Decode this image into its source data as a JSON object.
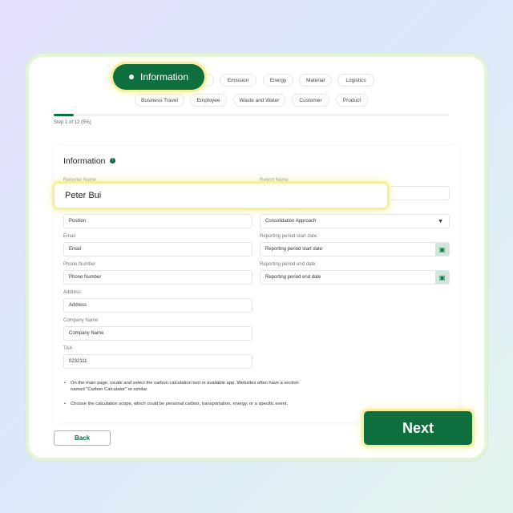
{
  "stepper": {
    "active": "Information",
    "row1": [
      "Emission",
      "Energy",
      "Material",
      "Logistics"
    ],
    "row2": [
      "Business Travel",
      "Employee",
      "Waste and Water",
      "Customer",
      "Product"
    ]
  },
  "progress": {
    "percent": 5,
    "text": "Step 1 of 12 (5%)"
  },
  "form": {
    "title": "Information",
    "reporter_name": {
      "label": "Reporter Name",
      "value": "Peter Bui"
    },
    "report_name": {
      "label": "Report Name",
      "value": ""
    },
    "position": {
      "label": "Position",
      "placeholder": "Position"
    },
    "consolidation": {
      "label": "Consolidation Approach",
      "value": "Consolidation Approach"
    },
    "email": {
      "label": "Email",
      "placeholder": "Email"
    },
    "start_date": {
      "label": "Reporting period start date:",
      "placeholder": "Reporting period start date"
    },
    "phone": {
      "label": "Phone Number",
      "placeholder": "Phone Number"
    },
    "end_date": {
      "label": "Reporting period end date:",
      "placeholder": "Reporting period end date"
    },
    "address": {
      "label": "Address",
      "placeholder": "Address"
    },
    "company": {
      "label": "Company Name",
      "placeholder": "Company Name"
    },
    "tax": {
      "label": "TAX",
      "value": "0232111"
    },
    "notes": [
      "On the main page, locate and select the carbon calculation tool or available app. Websites often have a section named \"Carbon Calculator\" or similar.",
      "Choose the calculation scope, which could be personal carbon, transportation, energy, or a specific event."
    ]
  },
  "buttons": {
    "back": "Back",
    "next": "Next"
  },
  "colors": {
    "brand": "#0f6e3d",
    "highlight": "#f5ef9c"
  }
}
